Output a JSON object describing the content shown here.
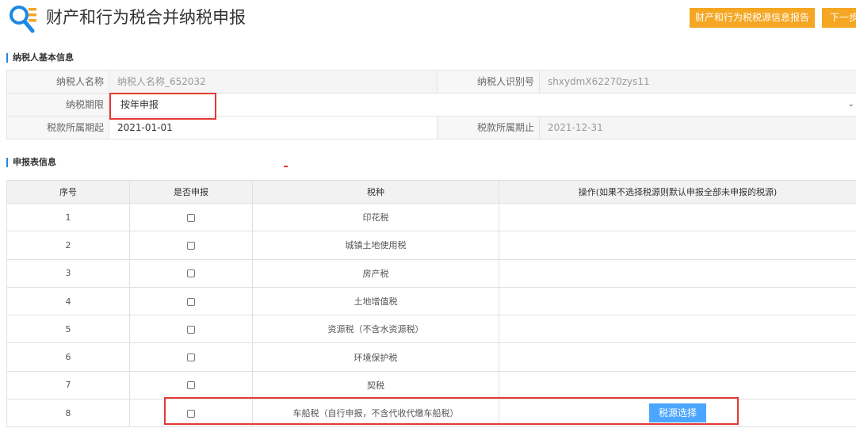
{
  "header": {
    "title": "财产和行为税合并纳税申报",
    "report_button": "财产和行为税税源信息报告",
    "next_button": "下一步"
  },
  "basic_info": {
    "section_title": "纳税人基本信息",
    "taxpayer_name_label": "纳税人名称",
    "taxpayer_name_value": "纳税人名称_652032",
    "taxpayer_id_label": "纳税人识别号",
    "taxpayer_id_value": "shxydmX62270zys11",
    "period_label": "纳税期限",
    "period_value": "按年申报",
    "start_label": "税款所属期起",
    "start_value": "2021-01-01",
    "end_label": "税款所属期止",
    "end_value": "2021-12-31"
  },
  "declaration": {
    "section_title": "申报表信息",
    "columns": [
      "序号",
      "是否申报",
      "税种",
      "操作(如果不选择税源则默认申报全部未申报的税源)"
    ],
    "rows": [
      {
        "no": "1",
        "tax": "印花税",
        "checked": false,
        "action": ""
      },
      {
        "no": "2",
        "tax": "城镇土地使用税",
        "checked": false,
        "action": ""
      },
      {
        "no": "3",
        "tax": "房产税",
        "checked": false,
        "action": ""
      },
      {
        "no": "4",
        "tax": "土地增值税",
        "checked": false,
        "action": ""
      },
      {
        "no": "5",
        "tax": "资源税（不含水资源税）",
        "checked": false,
        "action": ""
      },
      {
        "no": "6",
        "tax": "环境保护税",
        "checked": false,
        "action": ""
      },
      {
        "no": "7",
        "tax": "契税",
        "checked": false,
        "action": ""
      },
      {
        "no": "8",
        "tax": "车船税（自行申报，不含代收代缴车船税）",
        "checked": false,
        "action": "税源选择"
      }
    ]
  },
  "colors": {
    "accent_orange": "#f5a623",
    "accent_blue": "#4ca6ff",
    "highlight_red": "#e53935"
  },
  "icons": {
    "logo": "search-list-icon",
    "select_caret": "chevron-down-icon"
  }
}
